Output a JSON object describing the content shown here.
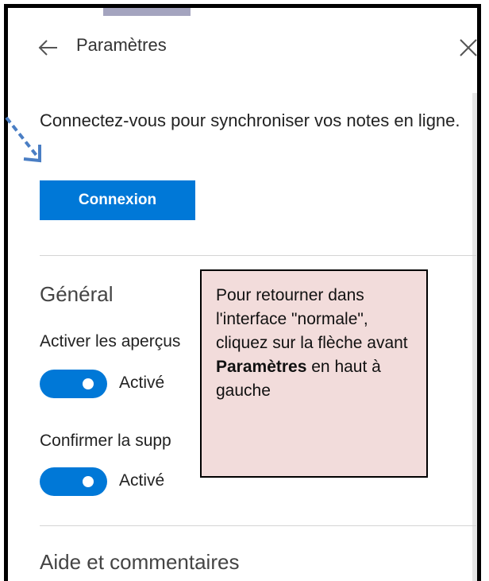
{
  "header": {
    "title": "Paramètres",
    "back_icon": "arrow-left-icon",
    "close_icon": "close-icon"
  },
  "sync": {
    "message": "Connectez-vous pour synchroniser vos notes en ligne.",
    "signin_label": "Connexion"
  },
  "general": {
    "heading": "Général",
    "settings": [
      {
        "label": "Activer les aperçus",
        "state": "Activé"
      },
      {
        "label": "Confirmer la supp",
        "state": "Activé"
      }
    ]
  },
  "help": {
    "heading": "Aide et commentaires"
  },
  "callout": {
    "text_before": "Pour retourner dans l'interface \"normale\", cliquez sur la flèche avant ",
    "text_bold": "Paramètres",
    "text_after": " en haut à gauche"
  },
  "colors": {
    "accent": "#0078d7",
    "callout_bg": "#f2dcdb",
    "annotation_arrow": "#4a7ec4"
  }
}
